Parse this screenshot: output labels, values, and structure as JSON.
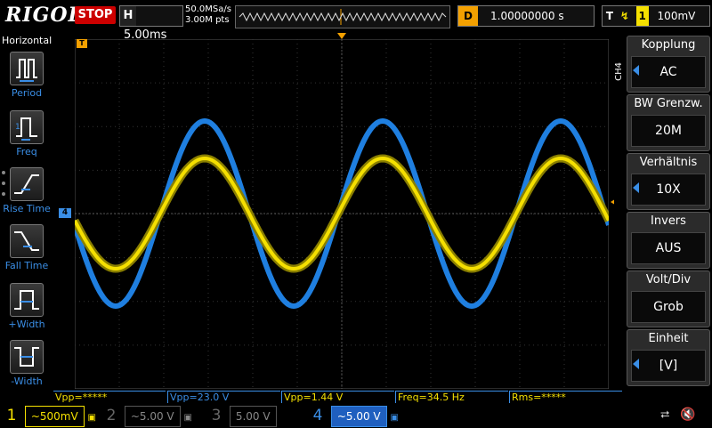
{
  "header": {
    "brand": "RIGOL",
    "run_state": "STOP",
    "timebase_letter": "H",
    "timebase": "5.00ms",
    "sample_rate": "50.0MSa/s",
    "memory_depth": "3.00M pts",
    "delay_letter": "D",
    "delay": "1.00000000 s",
    "trigger_letter": "T",
    "trigger_channel": "1",
    "trigger_level": "100mV"
  },
  "left_panel": {
    "title": "Horizontal",
    "items": [
      {
        "label": "Period"
      },
      {
        "label": "Freq"
      },
      {
        "label": "Rise Time"
      },
      {
        "label": "Fall Time"
      },
      {
        "label": "+Width"
      },
      {
        "label": "-Width"
      }
    ]
  },
  "right_menu": {
    "channel_tag": "CH4",
    "items": [
      {
        "title": "Kopplung",
        "value": "AC"
      },
      {
        "title": "BW Grenzw.",
        "value": "20M"
      },
      {
        "title": "Verhältnis",
        "value": "10X"
      },
      {
        "title": "Invers",
        "value": "AUS"
      },
      {
        "title": "Volt/Div",
        "value": "Grob"
      },
      {
        "title": "Einheit",
        "value": "[V]"
      }
    ]
  },
  "measurements": [
    {
      "text": "Vpp=*****"
    },
    {
      "text": "Vpp=23.0 V"
    },
    {
      "text": "Vpp=1.44 V"
    },
    {
      "text": "Freq=34.5 Hz"
    },
    {
      "text": "Rms=*****"
    }
  ],
  "channels": [
    {
      "num": "1",
      "scale": "~500mV",
      "color": "#f5e000"
    },
    {
      "num": "2",
      "scale": "~5.00 V",
      "color": "#666666"
    },
    {
      "num": "3",
      "scale": "5.00 V",
      "color": "#666666"
    },
    {
      "num": "4",
      "scale": "~5.00 V",
      "color": "#3a8ee6"
    }
  ],
  "channel_markers": {
    "ch1": "1",
    "ch4": "4",
    "trigger": "T"
  },
  "colors": {
    "ch1": "#f5e000",
    "ch4": "#1f7fe0",
    "accent": "#3a8ee6",
    "stop": "#cc0000",
    "delay": "#f3a000"
  }
}
